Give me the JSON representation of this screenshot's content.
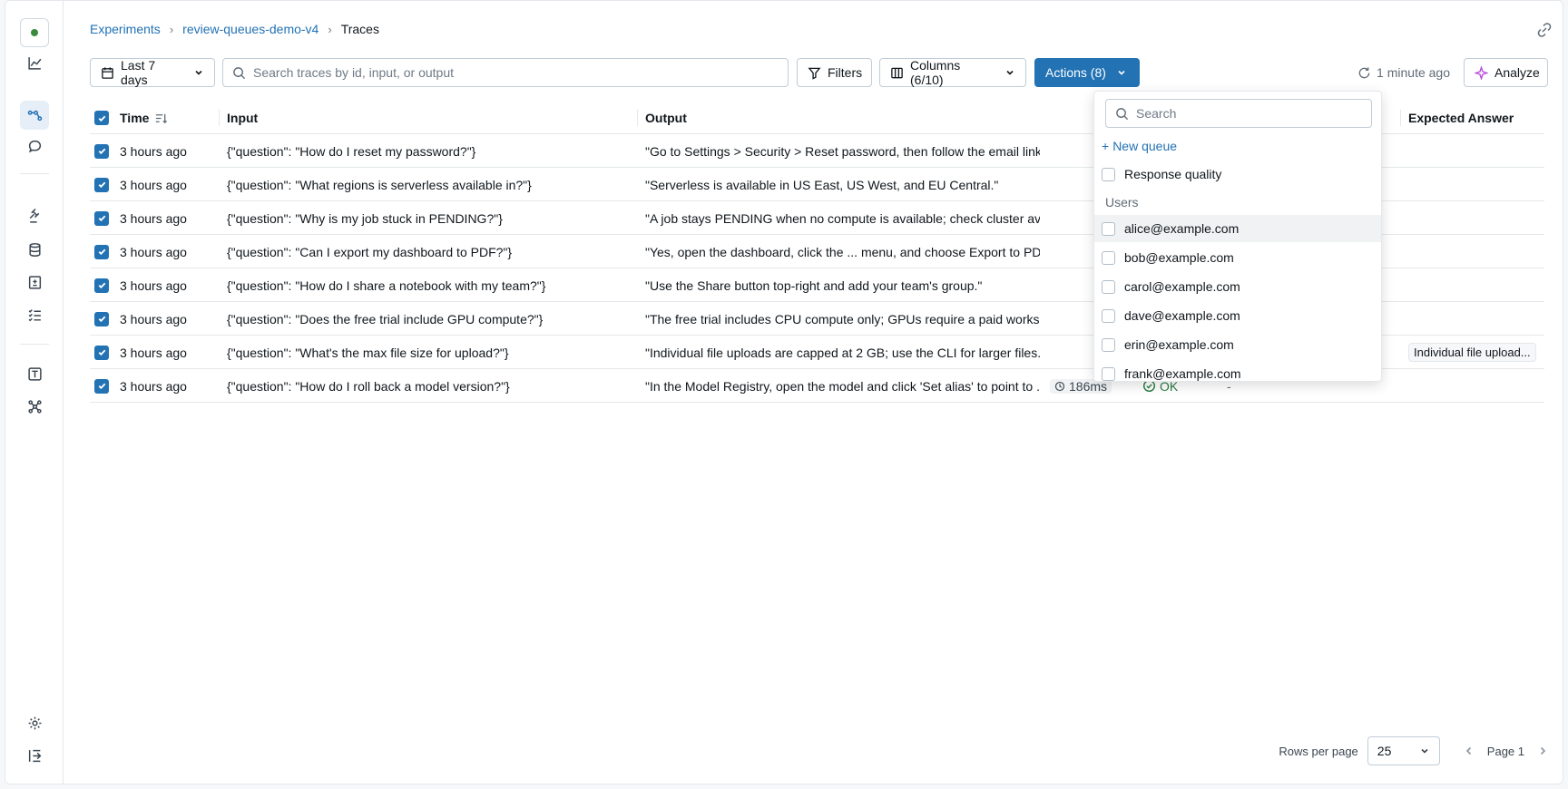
{
  "breadcrumb": [
    "Experiments",
    "review-queues-demo-v4",
    "Traces"
  ],
  "toolbar": {
    "date_range": "Last 7 days",
    "search_placeholder": "Search traces by id, input, or output",
    "filters": "Filters",
    "columns": "Columns (6/10)",
    "actions": "Actions (8)",
    "refreshed": "1 minute ago",
    "analyze": "Analyze"
  },
  "table": {
    "headers": {
      "time": "Time",
      "input": "Input",
      "output": "Output",
      "expected": "Expected Answer"
    },
    "rows": [
      {
        "time": "3 hours ago",
        "input": "{\"question\": \"How do I reset my password?\"}",
        "output": "\"Go to Settings > Security > Reset password, then follow the email link.\"",
        "expected": ""
      },
      {
        "time": "3 hours ago",
        "input": "{\"question\": \"What regions is serverless available in?\"}",
        "output": "\"Serverless is available in US East, US West, and EU Central.\"",
        "expected": ""
      },
      {
        "time": "3 hours ago",
        "input": "{\"question\": \"Why is my job stuck in PENDING?\"}",
        "output": "\"A job stays PENDING when no compute is available; check cluster av...",
        "expected": ""
      },
      {
        "time": "3 hours ago",
        "input": "{\"question\": \"Can I export my dashboard to PDF?\"}",
        "output": "\"Yes, open the dashboard, click the ... menu, and choose Export to PD...",
        "expected": ""
      },
      {
        "time": "3 hours ago",
        "input": "{\"question\": \"How do I share a notebook with my team?\"}",
        "output": "\"Use the Share button top-right and add your team's group.\"",
        "expected": ""
      },
      {
        "time": "3 hours ago",
        "input": "{\"question\": \"Does the free trial include GPU compute?\"}",
        "output": "\"The free trial includes CPU compute only; GPUs require a paid works...",
        "expected": ""
      },
      {
        "time": "3 hours ago",
        "input": "{\"question\": \"What's the max file size for upload?\"}",
        "output": "\"Individual file uploads are capped at 2 GB; use the CLI for larger files.\"",
        "expected": "Individual file upload..."
      },
      {
        "time": "3 hours ago",
        "input": "{\"question\": \"How do I roll back a model version?\"}",
        "output": "\"In the Model Registry, open the model and click 'Set alias' to point to ...",
        "expected": "",
        "latency": "186ms",
        "status": "OK",
        "extra": "-"
      }
    ]
  },
  "dropdown": {
    "search_placeholder": "Search",
    "new_queue": "New queue",
    "queues": [
      "Response quality"
    ],
    "section_users": "Users",
    "users": [
      "alice@example.com",
      "bob@example.com",
      "carol@example.com",
      "dave@example.com",
      "erin@example.com",
      "frank@example.com"
    ]
  },
  "footer": {
    "rows_per_page_label": "Rows per page",
    "rows_per_page": "25",
    "page": "Page 1"
  },
  "colors": {
    "accent": "#2272b4",
    "ok": "#277c43"
  }
}
